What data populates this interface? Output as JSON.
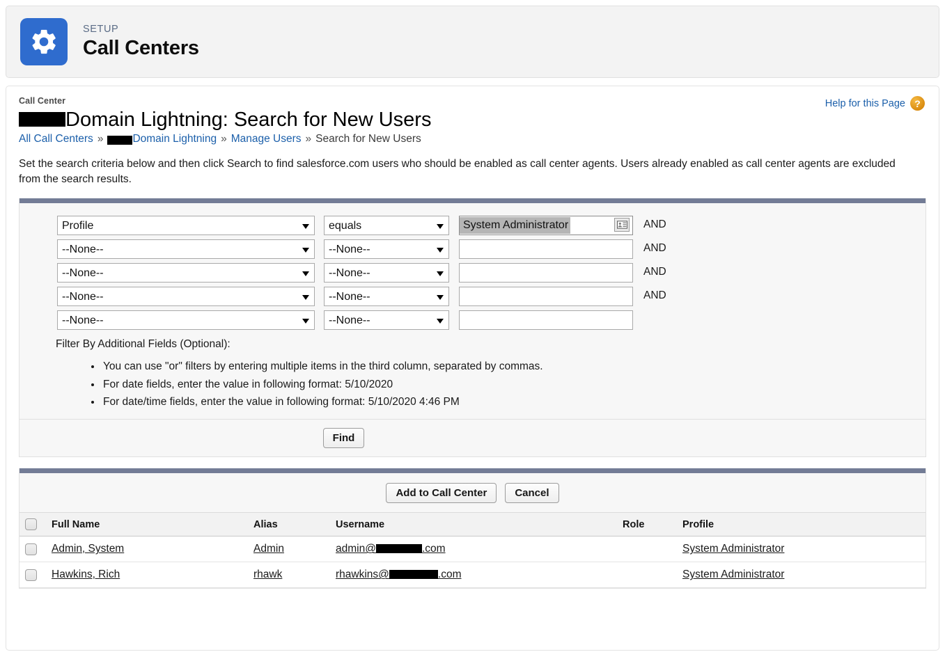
{
  "setup_header": {
    "eyebrow": "SETUP",
    "title": "Call Centers",
    "icon": "gear-icon",
    "icon_bg": "#2f6cce"
  },
  "page": {
    "eyebrow": "Call Center",
    "title_suffix": "Domain Lightning: Search for New Users",
    "title_redacted": true,
    "help_label": "Help for this Page",
    "help_icon": "question-mark-icon",
    "intro": "Set the search criteria below and then click Search to find salesforce.com users who should be enabled as call center agents. Users already enabled as call center agents are excluded from the search results."
  },
  "breadcrumb": {
    "items": [
      {
        "label": "All Call Centers",
        "link": true,
        "redacted": false
      },
      {
        "label": "Domain Lightning",
        "link": true,
        "redacted": true
      },
      {
        "label": "Manage Users",
        "link": true,
        "redacted": false
      },
      {
        "label": "Search for New Users",
        "link": false,
        "redacted": false
      }
    ],
    "separator": "»"
  },
  "search_panel": {
    "accent_color": "#737c96",
    "rows": [
      {
        "field": "Profile",
        "operator": "equals",
        "value": "System Administrator",
        "value_selected": true,
        "has_lookup": true,
        "conjunction": "AND"
      },
      {
        "field": "--None--",
        "operator": "--None--",
        "value": "",
        "value_selected": false,
        "has_lookup": false,
        "conjunction": "AND"
      },
      {
        "field": "--None--",
        "operator": "--None--",
        "value": "",
        "value_selected": false,
        "has_lookup": false,
        "conjunction": "AND"
      },
      {
        "field": "--None--",
        "operator": "--None--",
        "value": "",
        "value_selected": false,
        "has_lookup": false,
        "conjunction": "AND"
      },
      {
        "field": "--None--",
        "operator": "--None--",
        "value": "",
        "value_selected": false,
        "has_lookup": false,
        "conjunction": ""
      }
    ],
    "field_options": [
      "--None--",
      "Profile"
    ],
    "operator_options": [
      "--None--",
      "equals"
    ],
    "filter_note": "Filter By Additional Fields (Optional):",
    "hints": [
      "You can use \"or\" filters by entering multiple items in the third column, separated by commas.",
      "For date fields, enter the value in following format: 5/10/2020",
      "For date/time fields, enter the value in following format: 5/10/2020 4:46 PM"
    ],
    "find_button": "Find"
  },
  "results_panel": {
    "accent_color": "#737c96",
    "add_button": "Add to Call Center",
    "cancel_button": "Cancel",
    "columns": [
      "Full Name",
      "Alias",
      "Username",
      "Role",
      "Profile"
    ],
    "rows": [
      {
        "checked": false,
        "full_name": "Admin, System",
        "alias": "Admin",
        "username_prefix": "admin@",
        "username_redacted_width": 66,
        "username_suffix": ".com",
        "role": "",
        "profile": "System Administrator"
      },
      {
        "checked": false,
        "full_name": "Hawkins, Rich",
        "alias": "rhawk",
        "username_prefix": "rhawkins@",
        "username_redacted_width": 70,
        "username_suffix": ".com",
        "role": "",
        "profile": "System Administrator"
      }
    ]
  }
}
